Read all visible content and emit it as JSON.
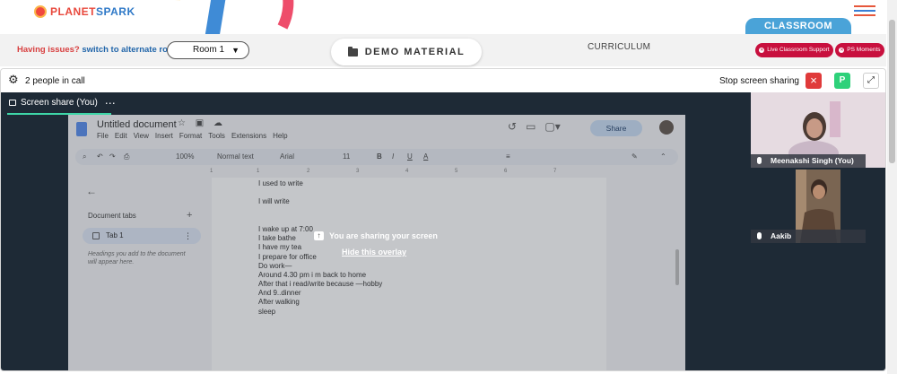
{
  "header": {
    "logo_text_part1": "PLANET",
    "logo_text_part2": "SPARK",
    "classroom_tab": "CLASSROOM",
    "menu_icon": "hamburger-icon"
  },
  "toolbar": {
    "issues_question": "Having issues?",
    "alternate_room_link": "switch to alternate room",
    "room_select": "Room 1",
    "demo_material": "DEMO MATERIAL",
    "curriculum": "CURRICULUM",
    "live_support": "Live Classroom Support",
    "ps_moments": "PS Moments"
  },
  "call": {
    "people_count": "2 people in call",
    "stop_sharing": "Stop screen sharing",
    "stop_icon": "×",
    "avatar_initial": "P",
    "fullscreen_icon": "⤢"
  },
  "share": {
    "tab_label": "Screen share (You)",
    "tab_more": "⋯",
    "overlay_message": "You are sharing your screen",
    "hide_overlay": "Hide this overlay"
  },
  "doc": {
    "title": "Untitled document",
    "title_icons": "☆ ▣ ☁",
    "menus": [
      "File",
      "Edit",
      "View",
      "Insert",
      "Format",
      "Tools",
      "Extensions",
      "Help"
    ],
    "share_button": "Share",
    "toolbar_items": {
      "zoom": "100%",
      "style": "Normal text",
      "font": "Arial",
      "size": "11",
      "bold": "B",
      "italic": "I",
      "underline": "U",
      "text_color": "A"
    },
    "ruler_marks": [
      "1",
      "1",
      "2",
      "3",
      "4",
      "5",
      "6",
      "7"
    ],
    "side": {
      "heading": "Document tabs",
      "tab1": "Tab 1",
      "note": "Headings you add to the document will appear here."
    },
    "lines": [
      "I used to write",
      "",
      "I will write",
      "",
      "",
      "I wake up at 7:00",
      "I take bathe",
      "I have my tea",
      "I prepare for office",
      "Do work—",
      "Around 4.30 pm i m back to home",
      "After that i read/write because —hobby",
      "And 9..dinner",
      "After walking",
      "sleep"
    ]
  },
  "participants": [
    {
      "name": "Meenakshi Singh (You)"
    },
    {
      "name": "Aakib"
    }
  ],
  "colors": {
    "brand_red": "#c8103e",
    "classroom_blue": "#4aa3d8",
    "share_accent": "#3ed6a8",
    "stage_bg": "#1e2a36",
    "stop_red": "#e03a3a",
    "avatar_green": "#2ed17a"
  }
}
